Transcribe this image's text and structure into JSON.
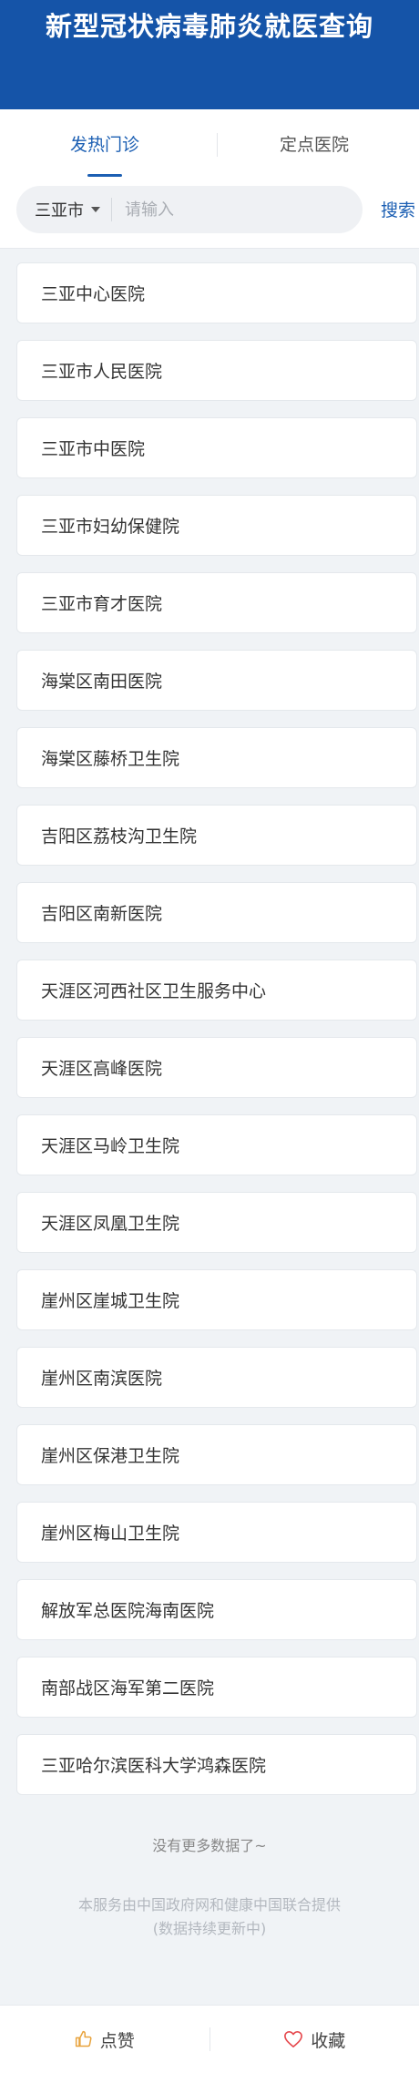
{
  "header": {
    "title": "新型冠状病毒肺炎就医查询"
  },
  "tabs": [
    {
      "label": "发热门诊",
      "active": true
    },
    {
      "label": "定点医院",
      "active": false
    }
  ],
  "search": {
    "city": "三亚市",
    "placeholder": "请输入",
    "value": "",
    "button_label": "搜索"
  },
  "hospitals": [
    "三亚中心医院",
    "三亚市人民医院",
    "三亚市中医院",
    "三亚市妇幼保健院",
    "三亚市育才医院",
    "海棠区南田医院",
    "海棠区藤桥卫生院",
    "吉阳区荔枝沟卫生院",
    "吉阳区南新医院",
    "天涯区河西社区卫生服务中心",
    "天涯区高峰医院",
    "天涯区马岭卫生院",
    "天涯区凤凰卫生院",
    "崖州区崖城卫生院",
    "崖州区南滨医院",
    "崖州区保港卫生院",
    "崖州区梅山卫生院",
    "解放军总医院海南医院",
    "南部战区海军第二医院",
    "三亚哈尔滨医科大学鸿森医院"
  ],
  "list_end_text": "没有更多数据了~",
  "footnote": {
    "line1": "本服务由中国政府网和健康中国联合提供",
    "line2": "(数据持续更新中)"
  },
  "bottom_bar": {
    "like_label": "点赞",
    "favorite_label": "收藏"
  },
  "colors": {
    "brand_blue": "#1554a8",
    "accent_blue": "#1c5fb3",
    "like_icon": "#e8a33d",
    "favorite_icon": "#e5484d"
  },
  "icons": {
    "caret": "caret-down-icon",
    "like": "thumbs-up-icon",
    "favorite": "heart-icon"
  }
}
